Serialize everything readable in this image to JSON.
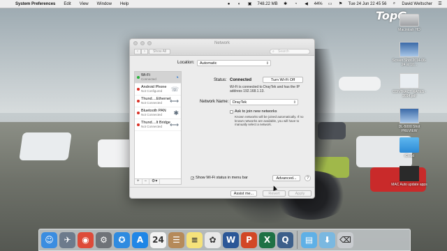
{
  "menubar": {
    "apple": "",
    "app_name": "System Preferences",
    "menus": [
      "Edit",
      "View",
      "Window",
      "Help"
    ],
    "net_speed": "748.22 MB",
    "battery": "44%",
    "datetime": "Tue 24 Jun  22 45 56",
    "user": "David Weltscher"
  },
  "desktop": {
    "logo": "TopG",
    "icons": [
      {
        "label": "Macintosh HD",
        "kind": "hdd"
      },
      {
        "label": "Screen Shot 2014-06-24 at 10...",
        "kind": "shot"
      },
      {
        "label": "CONTRACT RATES - 2014.pdf",
        "kind": "doc"
      },
      {
        "label": "DL-5000 Shot PREVIEW",
        "kind": "shot"
      },
      {
        "label": "iCloud",
        "kind": "folder"
      },
      {
        "label": "MAC Auto update apps",
        "kind": "app"
      }
    ]
  },
  "window": {
    "title": "Network",
    "toolbar": {
      "back": "‹",
      "forward": "›",
      "show_all": "Show All",
      "search_placeholder": "Search"
    },
    "location_label": "Location:",
    "location_value": "Automatic",
    "services": [
      {
        "name": "Wi-Fi",
        "status": "Connected",
        "color": "#27b33a",
        "icon": "wifi-icon",
        "glyph": "◔"
      },
      {
        "name": "Android Phone",
        "status": "Not Configured",
        "color": "#d93025",
        "icon": "phone-icon",
        "glyph": "☏"
      },
      {
        "name": "Thund....Ethernet",
        "status": "Not Connected",
        "color": "#d93025",
        "icon": "ethernet-icon",
        "glyph": "⟷"
      },
      {
        "name": "Bluetooth PAN",
        "status": "Not Connected",
        "color": "#d93025",
        "icon": "bluetooth-icon",
        "glyph": "✱"
      },
      {
        "name": "Thund....lt Bridge",
        "status": "Not Connected",
        "color": "#d93025",
        "icon": "bridge-icon",
        "glyph": "⟷"
      }
    ],
    "sidebar_buttons": {
      "add": "+",
      "remove": "−",
      "gear": "⚙▾"
    },
    "status_label": "Status:",
    "status_value": "Connected",
    "turn_off_label": "Turn Wi-Fi Off",
    "status_description": "Wi-Fi is connected to DrayTek and has the IP address 192.168.1.13.",
    "network_name_label": "Network Name:",
    "network_name_value": "DrayTek",
    "ask_join_label": "Ask to join new networks",
    "ask_join_desc": "Known networks will be joined automatically. If no known networks are available, you will have to manually select a network.",
    "show_wifi_label": "Show Wi-Fi status in menu bar",
    "advanced_label": "Advanced...",
    "help_label": "?",
    "assist_label": "Assist me...",
    "revert_label": "Revert",
    "apply_label": "Apply"
  },
  "dock": {
    "apps": [
      {
        "name": "finder",
        "color": "#3b8de0",
        "glyph": "☺"
      },
      {
        "name": "launchpad",
        "color": "#6d7b8c",
        "glyph": "✈"
      },
      {
        "name": "chrome",
        "color": "#dd4b39",
        "glyph": "◉"
      },
      {
        "name": "system-preferences",
        "color": "#6f7378",
        "glyph": "⚙"
      },
      {
        "name": "safari",
        "color": "#2e8be0",
        "glyph": "✪"
      },
      {
        "name": "app-store",
        "color": "#1f86e6",
        "glyph": "A"
      },
      {
        "name": "calendar",
        "color": "#f2f2f2",
        "glyph": "24"
      },
      {
        "name": "contacts",
        "color": "#b58a5a",
        "glyph": "☰"
      },
      {
        "name": "notes",
        "color": "#f5e27a",
        "glyph": "≡"
      },
      {
        "name": "photos",
        "color": "#e8e8e8",
        "glyph": "✿"
      },
      {
        "name": "word",
        "color": "#2b5797",
        "glyph": "W"
      },
      {
        "name": "powerpoint",
        "color": "#d24726",
        "glyph": "P"
      },
      {
        "name": "excel",
        "color": "#1e7145",
        "glyph": "X"
      },
      {
        "name": "quicktime",
        "color": "#3d5f8a",
        "glyph": "Q"
      },
      {
        "name": "documents-folder",
        "color": "#5fb0e6",
        "glyph": "▤"
      },
      {
        "name": "downloads-folder",
        "color": "#7ab8e0",
        "glyph": "⬇"
      },
      {
        "name": "trash",
        "color": "#c9ccd0",
        "glyph": "⌫"
      }
    ]
  }
}
